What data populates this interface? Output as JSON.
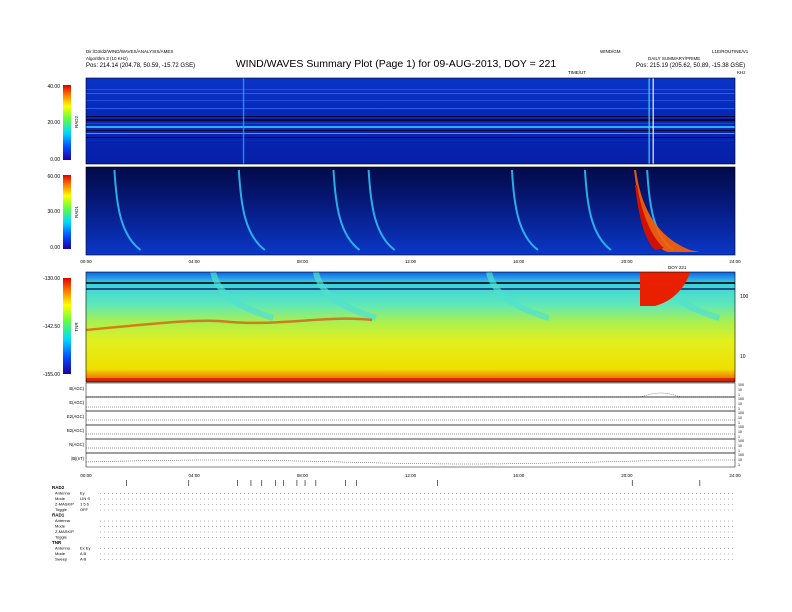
{
  "header": {
    "title": "WIND/WAVES Summary Plot (Page 1) for 09-AUG-2013, DOY = 221",
    "left_line1": "Dir:/D3/d2/WIND/WAVES/ANALYSIS/AMES",
    "left_line2": "Algorithm 3 (10 KHz)",
    "left_pos_label": "Pos:",
    "left_pos_value": "214.14 (204.78, 50.59, -15.72 GSE)",
    "center_right_line1": "WIND/GM",
    "center_right_line2": "TIME/UT",
    "right_line1": "L1E/ROUTINE/V1",
    "right_line2": "DAILY SUMMARY/PRIME",
    "right_pos_label": "Pos:",
    "right_pos_value": "215.19 (205.62, 50.89, -15.38 GSE)",
    "right_small": "KHz"
  },
  "labels": {
    "panel_rad2": "RAD2",
    "panel_rad1": "RAD1",
    "panel_tnr": "TNR",
    "panel_tnr_freq": "KHz/dB",
    "line_labels": [
      "B(AGC)",
      "E(AGC)",
      "E2(AGC)",
      "B2(AGC)",
      "N(AGC)",
      "|B|(nT)"
    ],
    "line_right": [
      "100",
      "10",
      "1",
      "100",
      "10",
      "1",
      "100",
      "10",
      "1",
      "100",
      "10",
      "1",
      "100",
      "10",
      "1",
      "100",
      "10",
      "1"
    ]
  },
  "colors": {
    "spectrogram_low": "#0016b0",
    "spectrogram_bg": "#061f9a",
    "tnr_hot": "#e02000",
    "tnr_yellow": "#e8e200",
    "tnr_green": "#8ce84a",
    "tnr_cyan": "#38d8d8"
  },
  "chart_data": [
    {
      "type": "heatmap",
      "name": "RAD2",
      "ylabel": "RAD2",
      "yticks": [
        "40.00",
        "20.00",
        "0.00"
      ],
      "colorbar": "rainbow",
      "xlim": [
        "00:00",
        "24:00"
      ],
      "features": [
        "type III burst near 21:00",
        "horizontal interference bands at 20-25 MHz"
      ]
    },
    {
      "type": "heatmap",
      "name": "RAD1",
      "ylabel": "RAD1",
      "yticks": [
        "60.00",
        "30.00",
        "0.00"
      ],
      "xticks": [
        "00:00",
        "04:00",
        "08:00",
        "12:00",
        "16:00",
        "20:00",
        "24:00"
      ],
      "colorbar": "rainbow",
      "bursts_hours": [
        1.2,
        5.8,
        9.3,
        10.6,
        15.9,
        18.6,
        20.9
      ]
    },
    {
      "type": "heatmap",
      "name": "TNR",
      "ylabel": "TNR",
      "yticks": [
        "-130.00",
        "-142.50",
        "-155.00"
      ],
      "right_ticks": [
        "100",
        "10"
      ],
      "top_right_label": "DOY 221",
      "colorbar": "rainbow",
      "bursts_hours": [
        4.7,
        8.5,
        14.9,
        21.2
      ]
    },
    {
      "type": "line",
      "name": "summary",
      "xticks": [
        "00:00",
        "04:00",
        "08:00",
        "12:00",
        "16:00",
        "20:00",
        "24:00"
      ],
      "series": [
        {
          "name": "B(AGC)"
        },
        {
          "name": "E(AGC)"
        },
        {
          "name": "E2(AGC)"
        },
        {
          "name": "B2(AGC)"
        },
        {
          "name": "N(AGC)"
        },
        {
          "name": "|B|(nT)"
        }
      ]
    }
  ],
  "footer": {
    "blocks": [
      {
        "name": "RAD2",
        "rows": [
          [
            "Antenna",
            "Ey"
          ],
          [
            "Mode",
            "LIN S"
          ],
          [
            "Z-MASK/P",
            "1 5 6"
          ],
          [
            "Toggle",
            "OFF"
          ]
        ]
      },
      {
        "name": "RAD1",
        "rows": [
          [
            "Antenna",
            ""
          ],
          [
            "Mode",
            ""
          ],
          [
            "Z-MASK/P",
            ""
          ],
          [
            "Toggle",
            ""
          ]
        ]
      },
      {
        "name": "TNR",
        "rows": [
          [
            "Antenna",
            "Ex Ey"
          ],
          [
            "Mode",
            "A B"
          ],
          [
            "Sweep",
            "A B"
          ]
        ]
      }
    ]
  }
}
